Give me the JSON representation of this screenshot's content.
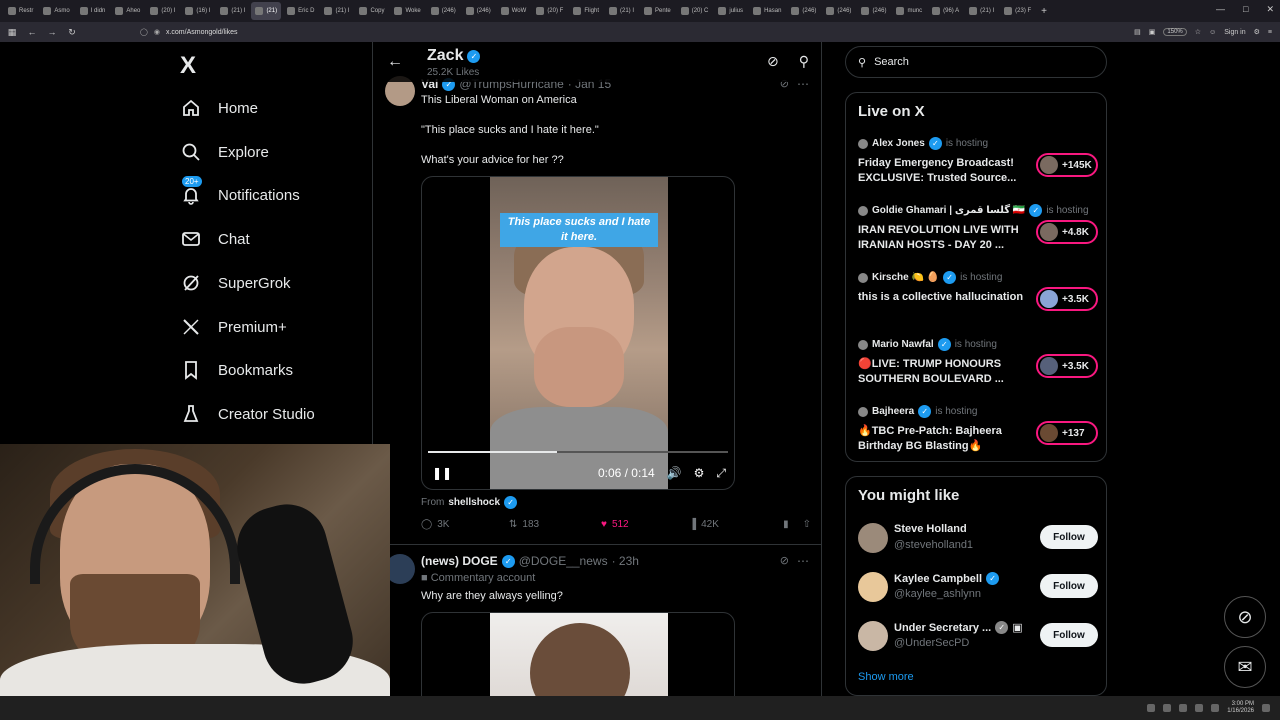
{
  "browser": {
    "tabs": [
      {
        "label": "Restr"
      },
      {
        "label": "Asmo"
      },
      {
        "label": "I didn"
      },
      {
        "label": "Aheo"
      },
      {
        "label": "(20) I"
      },
      {
        "label": "(16) I"
      },
      {
        "label": "(21) I"
      },
      {
        "label": "(21)",
        "active": true
      },
      {
        "label": "Eric D"
      },
      {
        "label": "(21) I"
      },
      {
        "label": "Copy"
      },
      {
        "label": "Woke"
      },
      {
        "label": "(246)"
      },
      {
        "label": "(246)"
      },
      {
        "label": "WoW"
      },
      {
        "label": "(20) F"
      },
      {
        "label": "Flight"
      },
      {
        "label": "(21) I"
      },
      {
        "label": "Pente"
      },
      {
        "label": "(20) C"
      },
      {
        "label": "julius"
      },
      {
        "label": "Hasan"
      },
      {
        "label": "(246)"
      },
      {
        "label": "(246)"
      },
      {
        "label": "(246)"
      },
      {
        "label": "munc"
      },
      {
        "label": "(96) A"
      },
      {
        "label": "(21) I"
      },
      {
        "label": "(23) F"
      }
    ],
    "url": "x.com/Asmongold/likes",
    "zoom": "150%",
    "signin": "Sign in"
  },
  "nav": {
    "logo": "X",
    "items": [
      {
        "label": "Home",
        "icon": "home-icon"
      },
      {
        "label": "Explore",
        "icon": "search-icon"
      },
      {
        "label": "Notifications",
        "icon": "bell-icon",
        "badge": "20+"
      },
      {
        "label": "Chat",
        "icon": "mail-icon"
      },
      {
        "label": "SuperGrok",
        "icon": "grok-icon"
      },
      {
        "label": "Premium+",
        "icon": "x-icon"
      },
      {
        "label": "Bookmarks",
        "icon": "bookmark-icon"
      },
      {
        "label": "Creator Studio",
        "icon": "creator-icon"
      }
    ]
  },
  "header": {
    "name": "Zack",
    "likes": "25.2K Likes"
  },
  "post1": {
    "name": "Val",
    "handle": "@TrumpsHurricane",
    "date": "· Jan 15",
    "line1": "This Liberal Woman on America",
    "line2": "\"This place sucks and I hate it here.\"",
    "line3": "What's your advice for her ??",
    "video_caption": "This place sucks and I hate it here.",
    "video_watermark": "@shellshock",
    "time": "0:06 / 0:14",
    "progress": 0.43,
    "from_label": "From",
    "from_source": "shellshock",
    "replies": "3K",
    "reposts": "183",
    "likes": "512",
    "views": "42K"
  },
  "post2": {
    "name": "(news) DOGE",
    "handle": "@DOGE__news",
    "date": "· 23h",
    "label": "Commentary account",
    "text": "Why are they always yelling?"
  },
  "sidebar": {
    "search_placeholder": "Search",
    "live_title": "Live on X",
    "hosting": "is hosting",
    "live": [
      {
        "host": "Alex Jones",
        "title": "Friday Emergency Broadcast! EXCLUSIVE: Trusted Source...",
        "count": "+145K"
      },
      {
        "host": "Goldie Ghamari | گلسا قمری 🇮🇷",
        "title": "IRAN REVOLUTION LIVE WITH IRANIAN HOSTS - DAY 20 ...",
        "count": "+4.8K"
      },
      {
        "host": "Kirsche 🍋 🥚",
        "title": "this is a collective hallucination",
        "count": "+3.5K"
      },
      {
        "host": "Mario Nawfal",
        "title": "🔴LIVE: TRUMP HONOURS SOUTHERN BOULEVARD ...",
        "count": "+3.5K"
      },
      {
        "host": "Bajheera",
        "title": "🔥TBC Pre-Patch: Bajheera Birthday BG Blasting🔥",
        "count": "+137"
      }
    ],
    "wtf_title": "You might like",
    "wtf": [
      {
        "name": "Steve Holland",
        "handle": "@steveholland1",
        "button": "Follow"
      },
      {
        "name": "Kaylee Campbell",
        "handle": "@kaylee_ashlynn",
        "button": "Follow"
      },
      {
        "name": "Under Secretary ...",
        "handle": "@UnderSecPD",
        "button": "Follow"
      }
    ],
    "show_more": "Show more"
  },
  "taskbar": {
    "time": "3:00 PM",
    "date": "1/16/2026"
  }
}
